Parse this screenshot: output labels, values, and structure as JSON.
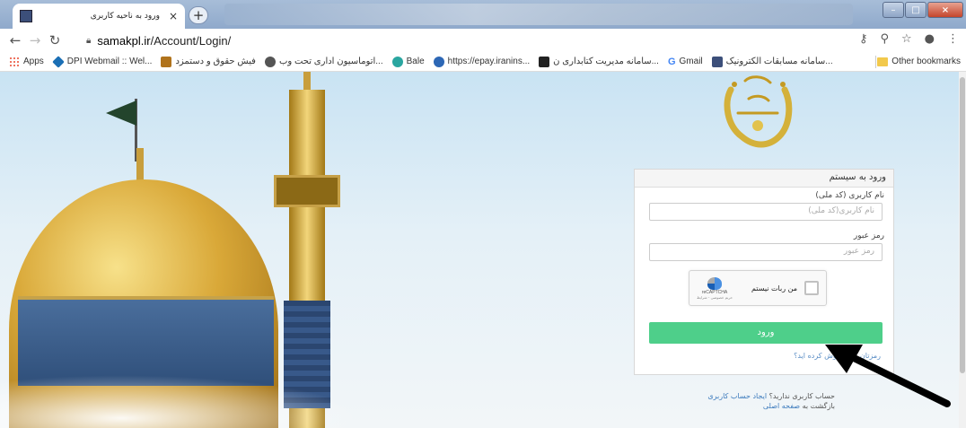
{
  "browser": {
    "tab_title": "ورود به ناحیه کاربری",
    "tab_close": "×",
    "new_tab": "+",
    "url_host": "samakpl.ir",
    "url_path": "/Account/Login/",
    "window_controls": {
      "minimize": "–",
      "maximize": "□",
      "close": "×"
    }
  },
  "bookmarks": {
    "items": [
      {
        "label": "Apps",
        "icon": "apps-grid-icon",
        "color": "#e8462b"
      },
      {
        "label": "DPI Webmail :: Wel...",
        "icon": "dpi-icon",
        "color": "#1b6fb5"
      },
      {
        "label": "فیش حقوق و دستمزد",
        "icon": "payslip-icon",
        "color": "#b0731c"
      },
      {
        "label": "اتوماسیون اداری تحت وب...",
        "icon": "globe-icon",
        "color": "#555555"
      },
      {
        "label": "Bale",
        "icon": "bale-icon",
        "color": "#2aa6a0"
      },
      {
        "label": "https://epay.iranins...",
        "icon": "epay-icon",
        "color": "#2d67b5"
      },
      {
        "label": "سامانه مدیریت کتابداری ن...",
        "icon": "library-icon",
        "color": "#222222"
      },
      {
        "label": "Gmail",
        "icon": "google-icon",
        "color": "#4285f4"
      },
      {
        "label": "سامانه مسابقات الکترونیک...",
        "icon": "contest-icon",
        "color": "#3c4f7a"
      }
    ],
    "other_label": "Other bookmarks",
    "other_icon": "folder-icon"
  },
  "login": {
    "header": "ورود به سیستم",
    "username_label": "نام کاربری (کد ملی)",
    "username_placeholder": "نام کاربری(کد ملی)",
    "password_label": "رمز عبور",
    "password_placeholder": "رمز عبور",
    "captcha_text": "من ربات نیستم",
    "captcha_brand": "reCAPTCHA",
    "captcha_sub": "حریم خصوصی - شرایط",
    "submit_label": "ورود",
    "forgot_link": "رمزتان را فراموش کرده اید؟"
  },
  "footer": {
    "no_account": "حساب کاربری ندارید؟",
    "create_account": "ایجاد حساب کاربری",
    "back_to": "بازگشت به",
    "home_link": "صفحه اصلی"
  },
  "colors": {
    "accent_green": "#4ecf8a",
    "link_blue": "#3d7bbd"
  }
}
